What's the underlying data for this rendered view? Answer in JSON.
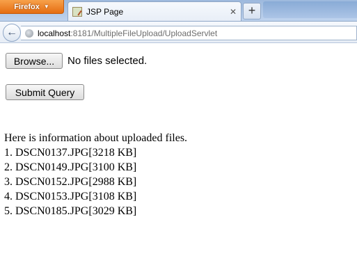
{
  "browser": {
    "app_button": "Firefox",
    "tab_title": "JSP Page",
    "new_tab": "+",
    "url_host": "localhost",
    "url_rest": ":8181/MultipleFileUpload/UploadServlet"
  },
  "form": {
    "browse_label": "Browse...",
    "file_status": "No files selected.",
    "submit_label": "Submit Query"
  },
  "result": {
    "heading": "Here is information about uploaded files.",
    "files": [
      "1. DSCN0137.JPG[3218 KB]",
      "2. DSCN0149.JPG[3100 KB]",
      "3. DSCN0152.JPG[2988 KB]",
      "4. DSCN0153.JPG[3108 KB]",
      "5. DSCN0185.JPG[3029 KB]"
    ]
  }
}
